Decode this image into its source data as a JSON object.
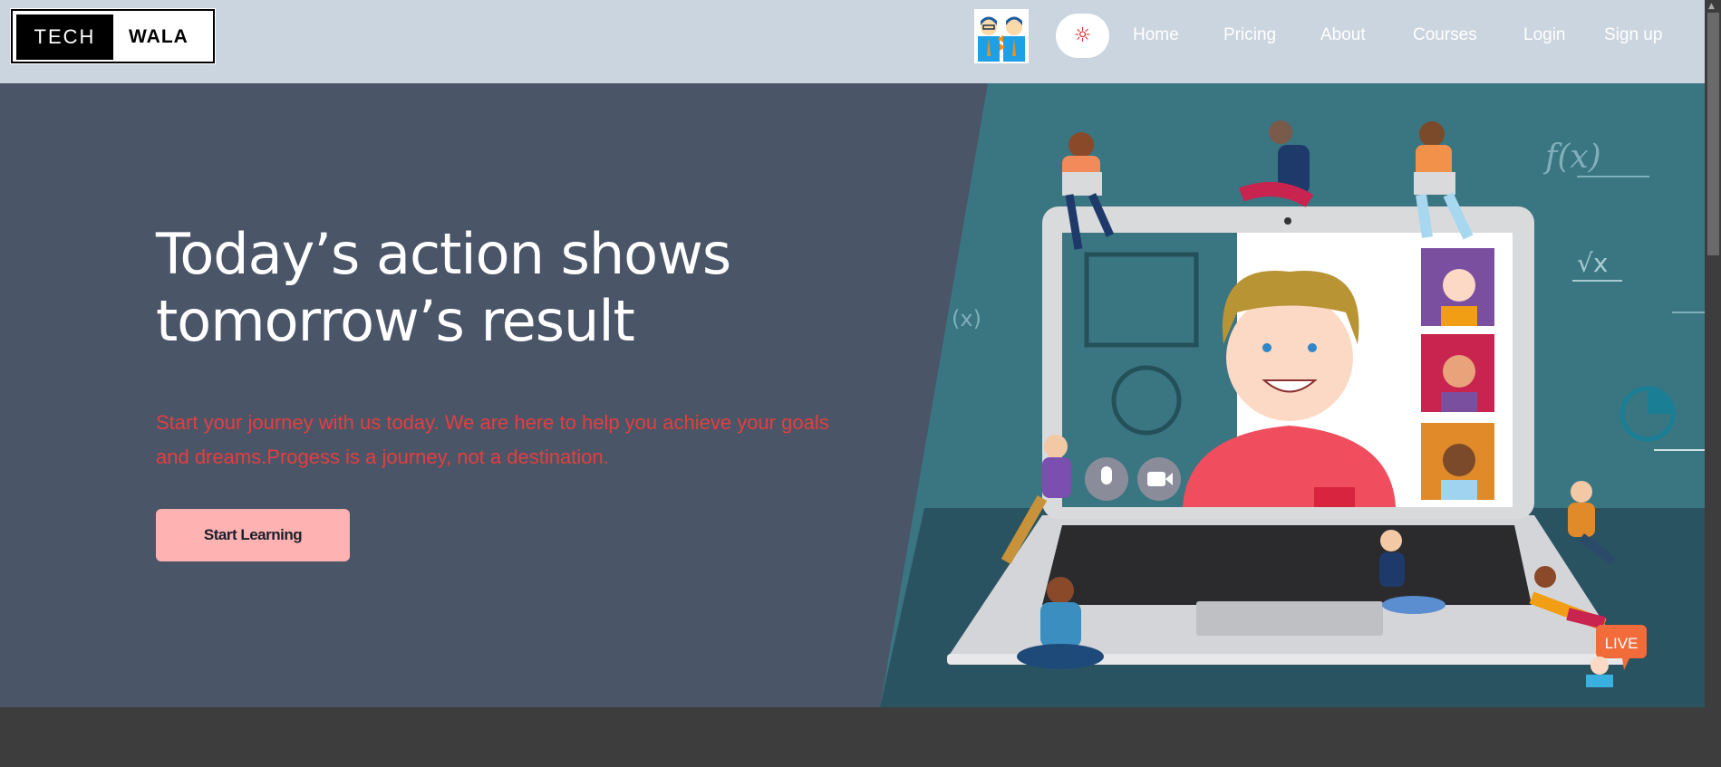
{
  "header": {
    "logo": {
      "left": "TECH",
      "right": "WALA"
    },
    "theme_toggle_icon": "sun-icon",
    "nav": [
      "Home",
      "Pricing",
      "About",
      "Courses",
      "Login",
      "Sign up"
    ]
  },
  "hero": {
    "title_line1": "Today’s action shows",
    "title_line2": "tomorrow’s result",
    "subtitle": "Start your journey with us today. We are here to help you achieve your goals and dreams.Progess is a journey, not a destination.",
    "cta_label": "Start Learning",
    "illustration": {
      "live_badge": "LIVE",
      "math_fx": "f(x)",
      "math_sqrt": "√x",
      "math_x": "(x)"
    }
  },
  "colors": {
    "header_bg": "#cbd5df",
    "hero_bg": "#4a5568",
    "accent_red": "#e53e3e",
    "cta_bg": "#feb2b2",
    "teal": "#3a7582"
  }
}
